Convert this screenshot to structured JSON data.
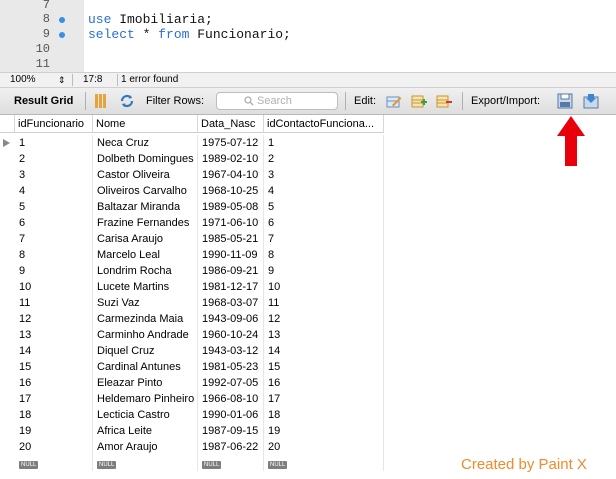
{
  "editor": {
    "lines": [
      {
        "num": "7",
        "has_dot": false,
        "code": ""
      },
      {
        "num": "8",
        "has_dot": true,
        "kw": "use",
        "rest": " Imobiliaria;"
      },
      {
        "num": "9",
        "has_dot": true,
        "kw": "select",
        "rest": " * ",
        "kw2": "from",
        "rest2": " Funcionario;"
      },
      {
        "num": "10",
        "has_dot": false,
        "code": ""
      },
      {
        "num": "11",
        "has_dot": false,
        "code": ""
      }
    ]
  },
  "status": {
    "zoom": "100%",
    "cursor": "17:8",
    "message": "1 error found"
  },
  "toolbar": {
    "result_grid": "Result Grid",
    "filter_rows": "Filter Rows:",
    "search_placeholder": "Search",
    "edit": "Edit:",
    "export_import": "Export/Import:"
  },
  "grid": {
    "columns": [
      "idFuncionario",
      "Nome",
      "Data_Nasc",
      "idContactoFunciona..."
    ],
    "rows": [
      [
        "1",
        "Neca Cruz",
        "1975-07-12",
        "1"
      ],
      [
        "2",
        "Dolbeth Domingues",
        "1989-02-10",
        "2"
      ],
      [
        "3",
        "Castor Oliveira",
        "1967-04-10",
        "3"
      ],
      [
        "4",
        "Oliveiros Carvalho",
        "1968-10-25",
        "4"
      ],
      [
        "5",
        "Baltazar Miranda",
        "1989-05-08",
        "5"
      ],
      [
        "6",
        "Frazine Fernandes",
        "1971-06-10",
        "6"
      ],
      [
        "7",
        "Carisa Araujo",
        "1985-05-21",
        "7"
      ],
      [
        "8",
        "Marcelo Leal",
        "1990-11-09",
        "8"
      ],
      [
        "9",
        "Londrim Rocha",
        "1986-09-21",
        "9"
      ],
      [
        "10",
        "Lucete Martins",
        "1981-12-17",
        "10"
      ],
      [
        "11",
        "Suzi Vaz",
        "1968-03-07",
        "11"
      ],
      [
        "12",
        "Carmezinda Maia",
        "1943-09-06",
        "12"
      ],
      [
        "13",
        "Carminho Andrade",
        "1960-10-24",
        "13"
      ],
      [
        "14",
        "Diquel Cruz",
        "1943-03-12",
        "14"
      ],
      [
        "15",
        "Cardinal Antunes",
        "1981-05-23",
        "15"
      ],
      [
        "16",
        "Eleazar Pinto",
        "1992-07-05",
        "16"
      ],
      [
        "17",
        "Heldemaro Pinheiro",
        "1966-08-10",
        "17"
      ],
      [
        "18",
        "Lecticia Castro",
        "1990-01-06",
        "18"
      ],
      [
        "19",
        "Africa Leite",
        "1987-09-15",
        "19"
      ],
      [
        "20",
        "Amor Araujo",
        "1987-06-22",
        "20"
      ]
    ],
    "null_label": "NULL"
  },
  "credit": "Created by Paint X",
  "colors": {
    "arrow": "#e8000b",
    "keyword": "#2a6fd6",
    "credit": "#f08a2a",
    "gutter_dot": "#3a8ee6"
  }
}
